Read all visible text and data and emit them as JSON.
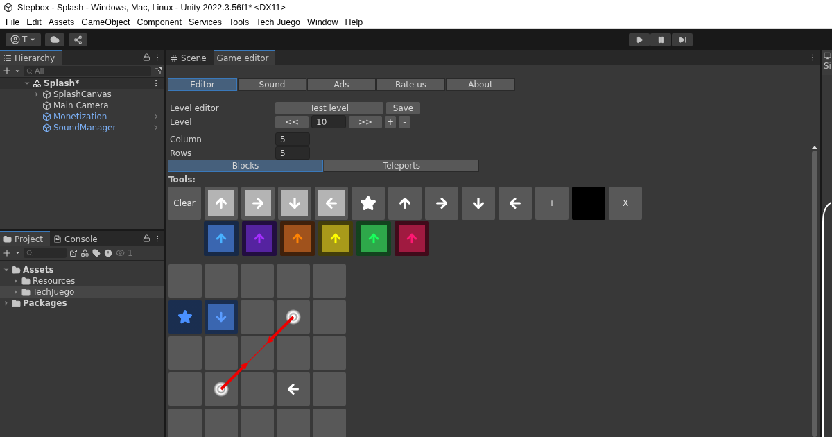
{
  "window": {
    "title": "Stepbox - Splash - Windows, Mac, Linux - Unity 2022.3.56f1* <DX11>"
  },
  "menu": [
    "File",
    "Edit",
    "Assets",
    "GameObject",
    "Component",
    "Services",
    "Tools",
    "Tech Juego",
    "Window",
    "Help"
  ],
  "toolbar": {
    "account": "T"
  },
  "hierarchy": {
    "title": "Hierarchy",
    "search": {
      "placeholder": "All"
    },
    "items": [
      {
        "label": "Splash*",
        "kind": "scene",
        "expanded": true,
        "children": [
          {
            "label": "SplashCanvas",
            "kind": "object",
            "expanded": false
          },
          {
            "label": "Main Camera",
            "kind": "object"
          },
          {
            "label": "Monetization",
            "kind": "prefab"
          },
          {
            "label": "SoundManager",
            "kind": "prefab"
          }
        ]
      }
    ]
  },
  "project": {
    "tabs": [
      {
        "label": "Project",
        "selected": true
      },
      {
        "label": "Console",
        "selected": false
      }
    ],
    "visible_count": "1",
    "items": [
      {
        "label": "Assets",
        "expanded": true,
        "selected": false,
        "children": [
          {
            "label": "Resources",
            "expanded": false,
            "selected": false
          },
          {
            "label": "TechJuego",
            "expanded": false,
            "selected": true
          }
        ]
      },
      {
        "label": "Packages",
        "expanded": false,
        "selected": false
      }
    ]
  },
  "main_tabs": [
    {
      "label": "Scene",
      "selected": false
    },
    {
      "label": "Game editor",
      "selected": true
    }
  ],
  "editor": {
    "tabs": [
      {
        "label": "Editor",
        "selected": true
      },
      {
        "label": "Sound",
        "selected": false
      },
      {
        "label": "Ads",
        "selected": false
      },
      {
        "label": "Rate us",
        "selected": false
      },
      {
        "label": "About",
        "selected": false
      }
    ],
    "level_editor_label": "Level editor",
    "test_button": "Test level",
    "save_button": "Save",
    "level_label": "Level",
    "prev_button": "<<",
    "level_value": "10",
    "next_button": ">>",
    "add_button": "+",
    "remove_button": "-",
    "columns_label": "Column",
    "columns_value": "5",
    "rows_label": "Rows",
    "rows_value": "5",
    "modes": [
      {
        "label": "Blocks",
        "selected": true
      },
      {
        "label": "Teleports",
        "selected": false
      }
    ],
    "tools_label": "Tools:",
    "tools": [
      {
        "kind": "text",
        "label": "Clear"
      },
      {
        "kind": "light_up"
      },
      {
        "kind": "light_right"
      },
      {
        "kind": "light_down"
      },
      {
        "kind": "light_left"
      },
      {
        "kind": "star"
      },
      {
        "kind": "up"
      },
      {
        "kind": "right"
      },
      {
        "kind": "down"
      },
      {
        "kind": "left"
      },
      {
        "kind": "text",
        "label": "+"
      },
      {
        "kind": "black"
      },
      {
        "kind": "text",
        "label": "X"
      }
    ],
    "color_tools": [
      {
        "color": "#3a66b0"
      },
      {
        "color": "#5523a0"
      },
      {
        "color": "#a0521c"
      },
      {
        "color": "#a89a1a"
      },
      {
        "color": "#2ea84a"
      },
      {
        "color": "#a01a40"
      }
    ],
    "grid": [
      [
        {
          "kind": "empty"
        },
        {
          "kind": "empty"
        },
        {
          "kind": "empty"
        },
        {
          "kind": "empty"
        },
        {
          "kind": "empty"
        }
      ],
      [
        {
          "kind": "star",
          "color": "#3a66b0"
        },
        {
          "kind": "down",
          "color": "#3a66b0"
        },
        {
          "kind": "empty"
        },
        {
          "kind": "teleport"
        },
        {
          "kind": "empty"
        }
      ],
      [
        {
          "kind": "empty"
        },
        {
          "kind": "empty"
        },
        {
          "kind": "empty"
        },
        {
          "kind": "empty"
        },
        {
          "kind": "empty"
        }
      ],
      [
        {
          "kind": "empty"
        },
        {
          "kind": "teleport"
        },
        {
          "kind": "empty"
        },
        {
          "kind": "left"
        },
        {
          "kind": "empty"
        }
      ],
      [
        {
          "kind": "empty"
        },
        {
          "kind": "empty"
        },
        {
          "kind": "empty"
        },
        {
          "kind": "empty"
        },
        {
          "kind": "empty"
        }
      ]
    ]
  },
  "side_panel": {
    "label": "Si"
  }
}
